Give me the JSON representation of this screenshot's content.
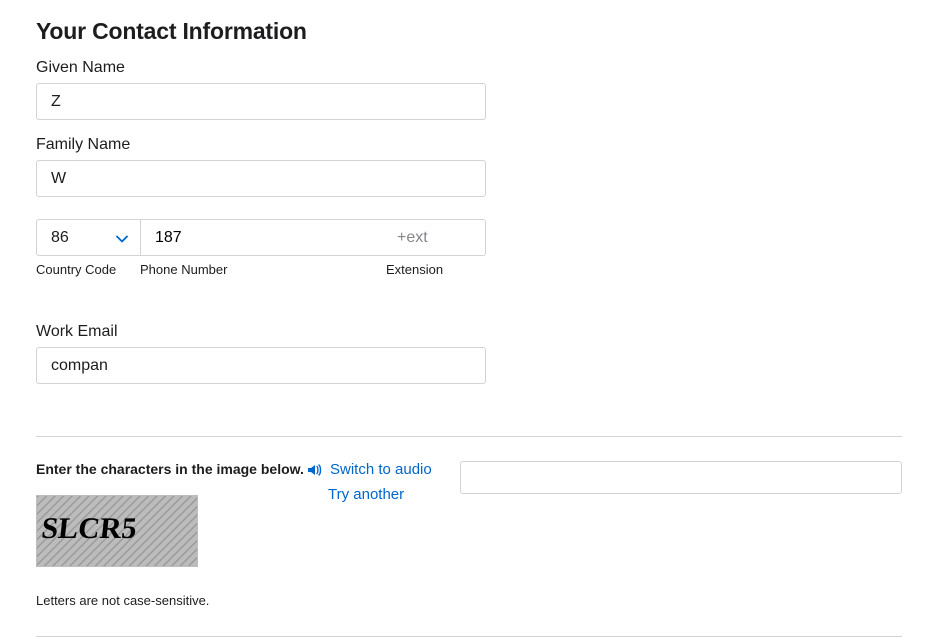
{
  "section_title": "Your Contact Information",
  "given_name": {
    "label": "Given Name",
    "value": "Z"
  },
  "family_name": {
    "label": "Family Name",
    "value": "W"
  },
  "phone": {
    "country_code_label": "Country Code",
    "phone_number_label": "Phone Number",
    "extension_label": "Extension",
    "country_code_value": "86",
    "phone_number_value": "187",
    "extension_placeholder": "+ext"
  },
  "work_email": {
    "label": "Work Email",
    "value": "compan"
  },
  "captcha": {
    "prompt": "Enter the characters in the image below.",
    "image_text": "SLCR5",
    "switch_to_audio": "Switch to audio",
    "try_another": "Try another",
    "note": "Letters are not case-sensitive.",
    "input_value": ""
  }
}
